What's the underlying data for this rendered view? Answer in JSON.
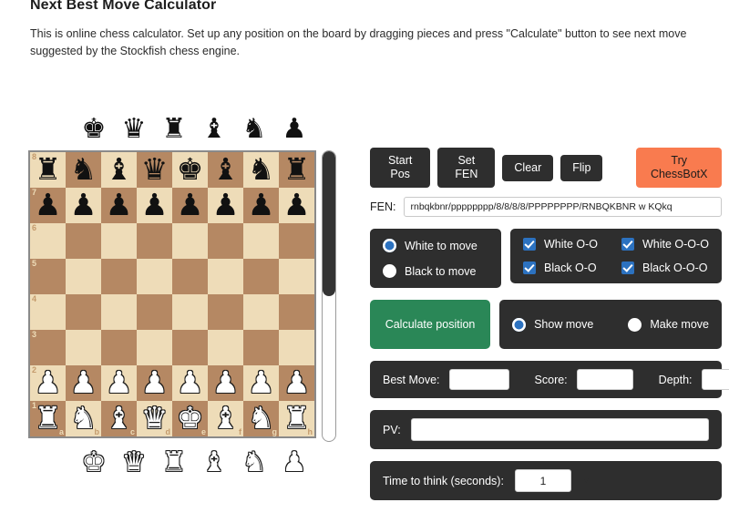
{
  "header": {
    "title": "Next Best Move Calculator",
    "description": "This is online chess calculator. Set up any position on the board by dragging pieces and press \"Calculate\" button to see next move suggested by the Stockfish chess engine."
  },
  "toolbar": {
    "start_pos_label": "Start Pos",
    "set_fen_label": "Set FEN",
    "clear_label": "Clear",
    "flip_label": "Flip",
    "chessbotx_label": "Try ChessBotX"
  },
  "fen": {
    "label": "FEN:",
    "value": "rnbqkbnr/pppppppp/8/8/8/8/PPPPPPPP/RNBQKBNR w KQkq",
    "placeholder": "rnbqkbnr/pppppppp/8/8/8/8/PPPPPPPP/RNBQKBNR w KQkq"
  },
  "turn": {
    "white_label": "White to move",
    "black_label": "Black to move",
    "selected": "white"
  },
  "castling": {
    "white_oo_label": "White O-O",
    "white_ooo_label": "White O-O-O",
    "black_oo_label": "Black O-O",
    "black_ooo_label": "Black O-O-O",
    "white_oo_checked": true,
    "white_ooo_checked": true,
    "black_oo_checked": true,
    "black_ooo_checked": true
  },
  "calculate": {
    "button_label": "Calculate position"
  },
  "move_mode": {
    "show_label": "Show move",
    "make_label": "Make move",
    "selected": "show"
  },
  "result": {
    "best_move_label": "Best Move:",
    "best_move_value": "",
    "score_label": "Score:",
    "score_value": "",
    "depth_label": "Depth:",
    "depth_value": "",
    "pv_label": "PV:",
    "pv_value": ""
  },
  "time": {
    "label": "Time to think (seconds):",
    "value": "1"
  },
  "board": {
    "light_color": "#EEDCB8",
    "dark_color": "#B58863",
    "files": [
      "a",
      "b",
      "c",
      "d",
      "e",
      "f",
      "g",
      "h"
    ],
    "ranks": [
      "8",
      "7",
      "6",
      "5",
      "4",
      "3",
      "2",
      "1"
    ],
    "rows": [
      [
        "r",
        "n",
        "b",
        "q",
        "k",
        "b",
        "n",
        "r"
      ],
      [
        "p",
        "p",
        "p",
        "p",
        "p",
        "p",
        "p",
        "p"
      ],
      [
        "",
        "",
        "",
        "",
        "",
        "",
        "",
        ""
      ],
      [
        "",
        "",
        "",
        "",
        "",
        "",
        "",
        ""
      ],
      [
        "",
        "",
        "",
        "",
        "",
        "",
        "",
        ""
      ],
      [
        "",
        "",
        "",
        "",
        "",
        "",
        "",
        ""
      ],
      [
        "P",
        "P",
        "P",
        "P",
        "P",
        "P",
        "P",
        "P"
      ],
      [
        "R",
        "N",
        "B",
        "Q",
        "K",
        "B",
        "N",
        "R"
      ]
    ],
    "scroll_thumb_percent": 50
  },
  "trays": {
    "black": [
      "king",
      "queen",
      "rook",
      "bishop",
      "knight",
      "pawn"
    ],
    "white": [
      "king",
      "queen",
      "rook",
      "bishop",
      "knight",
      "pawn"
    ]
  },
  "glyphs": {
    "k": "♚",
    "q": "♛",
    "r": "♜",
    "b": "♝",
    "n": "♞",
    "p": "♟",
    "K": "♚",
    "Q": "♛",
    "R": "♜",
    "B": "♝",
    "N": "♞",
    "P": "♟"
  },
  "colors": {
    "panel": "#2E2E2E",
    "accent_green": "#2A8757",
    "accent_orange": "#F97B4F",
    "accent_blue": "#2C72C0"
  }
}
